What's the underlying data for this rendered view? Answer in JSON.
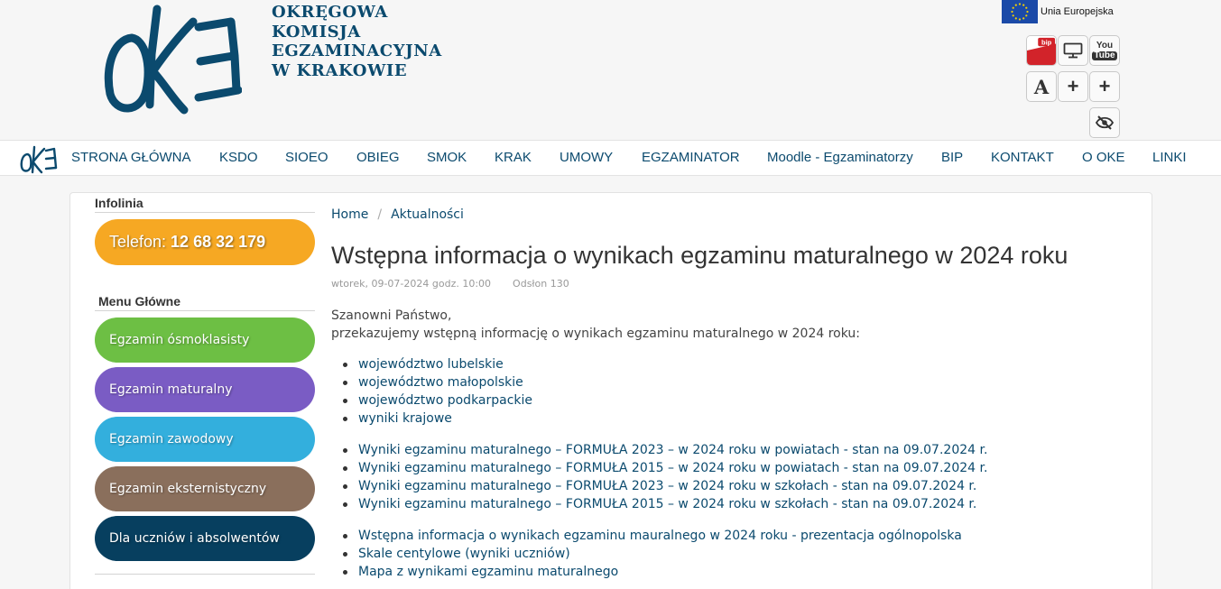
{
  "header": {
    "org_lines": [
      "OKRĘGOWA",
      "KOMISJA",
      "EGZAMINACYJNA",
      "W KRAKOWIE"
    ],
    "eu_label": "Unia Europejska",
    "tools": {
      "bip_label": "bip",
      "youtube_top": "You",
      "youtube_bottom": "Tube",
      "font_label": "A",
      "plus_1": "+",
      "plus_2": "+"
    }
  },
  "nav": {
    "items": [
      "STRONA GŁÓWNA",
      "KSDO",
      "SIOEO",
      "OBIEG",
      "SMOK",
      "KRAK",
      "UMOWY",
      "EGZAMINATOR",
      "Moodle - Egzaminatorzy",
      "BIP",
      "KONTAKT",
      "O OKE",
      "LINKI"
    ]
  },
  "sidebar": {
    "infolinia_heading": "Infolinia",
    "phone_prefix": "Telefon: ",
    "phone_number": "12 68 32 179",
    "menu_heading": "Menu Główne",
    "menu": [
      {
        "label": "Egzamin ósmoklasisty",
        "color": "#6dbf44"
      },
      {
        "label": "Egzamin maturalny",
        "color": "#7a5cc4"
      },
      {
        "label": "Egzamin zawodowy",
        "color": "#33afdd"
      },
      {
        "label": "Egzamin eksternistyczny",
        "color": "#8a6f5c"
      },
      {
        "label": "Dla uczniów i absolwentów",
        "color": "#073f5f"
      }
    ]
  },
  "main": {
    "breadcrumb": {
      "home": "Home",
      "separator": "/",
      "current": "Aktualności"
    },
    "title": "Wstępna informacja o wynikach egzaminu maturalnego w 2024 roku",
    "date": "wtorek, 09-07-2024 godz. 10:00",
    "views": "Odsłon 130",
    "intro_1": "Szanowni Państwo,",
    "intro_2": "przekazujemy wstępną informację o wynikach egzaminu maturalnego w 2024 roku:",
    "list_1": [
      "województwo lubelskie",
      "województwo małopolskie",
      "województwo podkarpackie",
      "wyniki krajowe"
    ],
    "list_2": [
      "Wyniki egzaminu maturalnego – FORMUŁA 2023 – w 2024 roku w powiatach - stan na 09.07.2024 r.",
      "Wyniki egzaminu maturalnego – FORMUŁA 2015 – w 2024 roku w powiatach - stan na 09.07.2024 r.",
      "Wyniki egzaminu maturalnego – FORMUŁA 2023 – w 2024 roku w szkołach - stan na 09.07.2024 r.",
      "Wyniki egzaminu maturalnego – FORMUŁA 2015 – w 2024 roku w szkołach - stan na 09.07.2024 r."
    ],
    "list_3": [
      "Wstępna informacja o wynikach egzaminu mauralnego w 2024 roku - prezentacja ogólnopolska",
      "Skale centylowe (wyniki uczniów)",
      "Mapa z wynikami egzaminu maturalnego"
    ]
  }
}
